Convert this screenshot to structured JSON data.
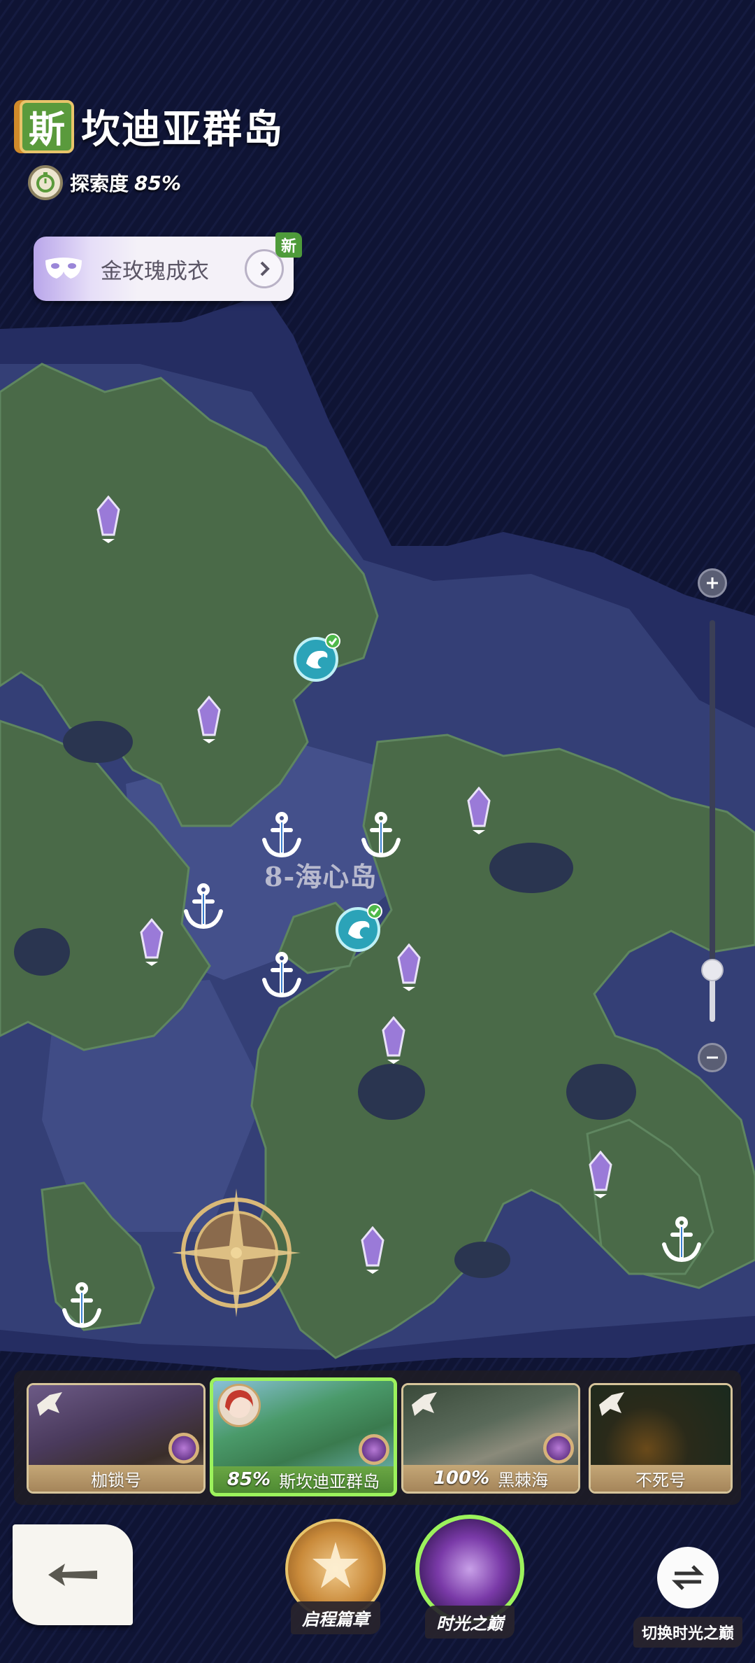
{
  "region": {
    "badge": "斯",
    "title": "坎迪亚群岛",
    "explore_label": "探索度",
    "explore_value": "85%"
  },
  "quest": {
    "label": "金玫瑰成衣",
    "badge": "新"
  },
  "map": {
    "area_label": "8-海心岛"
  },
  "zoom": {
    "level": 0.13
  },
  "chapters": [
    {
      "name": "枷锁号",
      "percent": "",
      "active": false
    },
    {
      "name": "斯坎迪亚群岛",
      "percent": "85%",
      "active": true
    },
    {
      "name": "黑棘海",
      "percent": "100%",
      "active": false
    },
    {
      "name": "不死号",
      "percent": "",
      "active": false
    }
  ],
  "nav": {
    "chapter_label": "启程篇章",
    "time_label": "时光之巅",
    "switch_label": "切换时光之巅"
  },
  "colors": {
    "land": "#4a6a48",
    "shallow": "#3d4a7c",
    "deep": "#1a1e48",
    "active_chapter": "#9cf25c"
  }
}
